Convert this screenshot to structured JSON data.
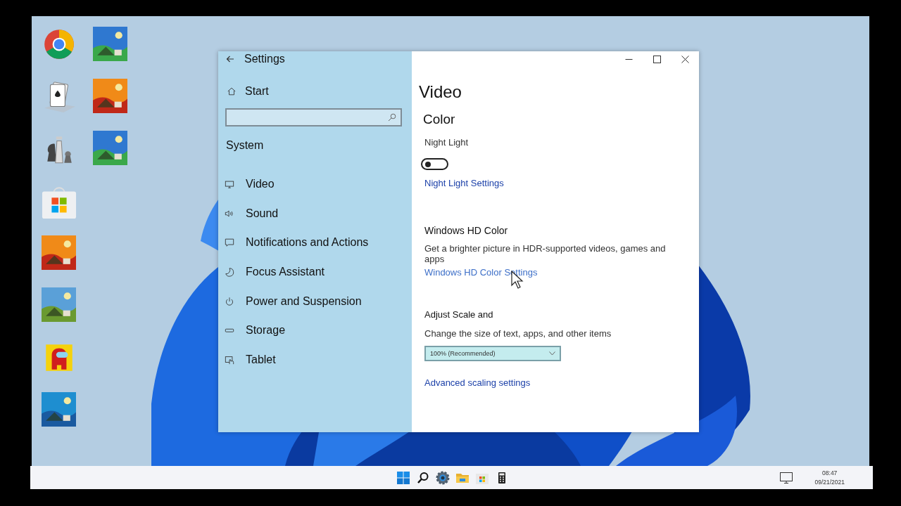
{
  "desktop_icons": [
    {
      "kind": "chrome"
    },
    {
      "kind": "picture"
    },
    {
      "kind": "cards"
    },
    {
      "kind": "picture"
    },
    {
      "kind": "chess"
    },
    {
      "kind": "picture"
    },
    {
      "kind": "store"
    },
    {
      "kind": "picture"
    },
    {
      "kind": "picture"
    },
    {
      "kind": "crewmate"
    },
    {
      "kind": "picture"
    }
  ],
  "window": {
    "title": "Settings"
  },
  "sidebar": {
    "home": "Start",
    "section": "System",
    "items": [
      {
        "label": "Video",
        "kind": "monitor"
      },
      {
        "label": "Sound",
        "kind": "speaker"
      },
      {
        "label": "Notifications and Actions",
        "kind": "message"
      },
      {
        "label": "Focus Assistant",
        "kind": "moon"
      },
      {
        "label": "Power and Suspension",
        "kind": "power"
      },
      {
        "label": "Storage",
        "kind": "drive"
      },
      {
        "label": "Tablet",
        "kind": "tablet"
      }
    ]
  },
  "content": {
    "title": "Video",
    "section": "Color",
    "night_light": {
      "label": "Night Light",
      "on": false,
      "link": "Night Light Settings"
    },
    "hd_color": {
      "heading": "Windows HD Color",
      "description": "Get a brighter picture in HDR-supported videos, games and apps",
      "link": "Windows HD Color Settings"
    },
    "scale": {
      "heading": "Adjust Scale and",
      "description": "Change the size of text, apps, and other items",
      "dropdown": {
        "value": "100% (Recommended)"
      },
      "link": "Advanced scaling settings"
    }
  },
  "taskbar": {
    "apps": [
      {
        "kind": "windows"
      },
      {
        "kind": "search"
      },
      {
        "kind": "gear"
      },
      {
        "kind": "folder"
      },
      {
        "kind": "store"
      },
      {
        "kind": "calculator"
      }
    ],
    "time": "08:47",
    "date": "09/21/2021"
  }
}
